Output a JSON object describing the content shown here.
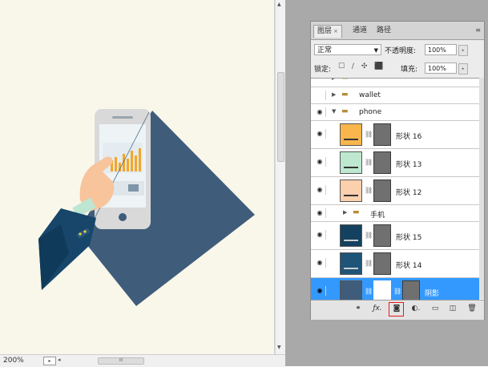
{
  "canvas": {
    "bg_color": "#f9f7ea",
    "zoom_label": "200%",
    "scroll_thumb_label": "III",
    "colors": {
      "shadow": "#3f5d7b",
      "phone_body": "#d9d9d9",
      "sleeve": "#17466a",
      "screen": "#eef3f6",
      "bars": "#f3a628",
      "hand": "#f7c49c"
    }
  },
  "panel": {
    "tabs": [
      {
        "label": "图层",
        "active": true
      },
      {
        "label": "通道",
        "active": false
      },
      {
        "label": "路径",
        "active": false
      }
    ],
    "blend_mode": "正常",
    "opacity_label": "不透明度:",
    "opacity_value": "100%",
    "lock_label": "锁定:",
    "fill_label": "填充:",
    "fill_value": "100%"
  },
  "layers": [
    {
      "name": "wallet",
      "kind": "group",
      "visible": false
    },
    {
      "name": "phone",
      "kind": "group",
      "expanded": true,
      "visible": true
    },
    {
      "name": "形状 16",
      "kind": "shape",
      "color": "#f8b64c",
      "visible": true
    },
    {
      "name": "形状 13",
      "kind": "shape",
      "color": "#bde8cf",
      "visible": true
    },
    {
      "name": "形状 12",
      "kind": "shape",
      "color": "#fbd0ad",
      "visible": true
    },
    {
      "name": "手机",
      "kind": "group",
      "visible": true
    },
    {
      "name": "形状 15",
      "kind": "shape",
      "color": "#14415f",
      "visible": true
    },
    {
      "name": "形状 14",
      "kind": "shape",
      "color": "#1d5478",
      "visible": true
    },
    {
      "name": "阴影",
      "kind": "shape",
      "color": "#3f5d7b",
      "visible": true,
      "selected": true
    }
  ],
  "bottom_icons": [
    "link-icon",
    "fx-icon",
    "add-mask-icon",
    "adjustment-icon",
    "new-group-icon",
    "new-layer-icon",
    "trash-icon"
  ]
}
